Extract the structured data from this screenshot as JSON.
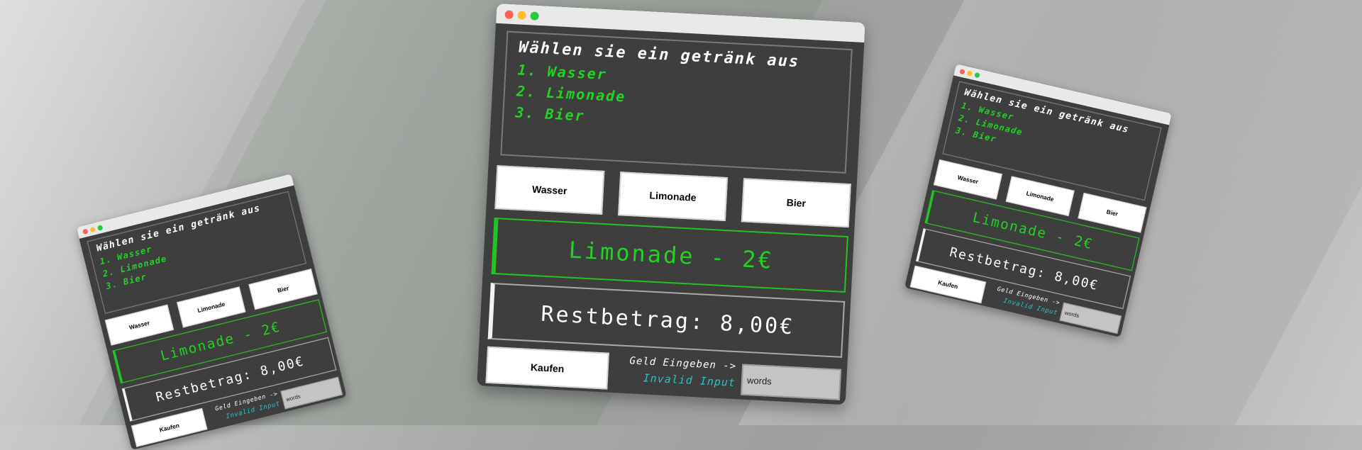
{
  "app": {
    "menu": {
      "title": "Wählen sie ein getränk aus",
      "items": [
        "1. Wasser",
        "2. Limonade",
        "3. Bier"
      ]
    },
    "buttons": {
      "wasser": "Wasser",
      "limonade": "Limonade",
      "bier": "Bier",
      "kaufen": "Kaufen"
    },
    "selection": "Limonade - 2€",
    "balance": "Restbetrag: 8,00€",
    "money_label": "Geld Eingeben ->",
    "error": "Invalid Input",
    "money_input_value": "words"
  },
  "colors": {
    "window_bg": "#3e3e3e",
    "accent_green": "#22d322",
    "error_cyan": "#29c4c4",
    "titlebar": "#e9e9e9"
  }
}
